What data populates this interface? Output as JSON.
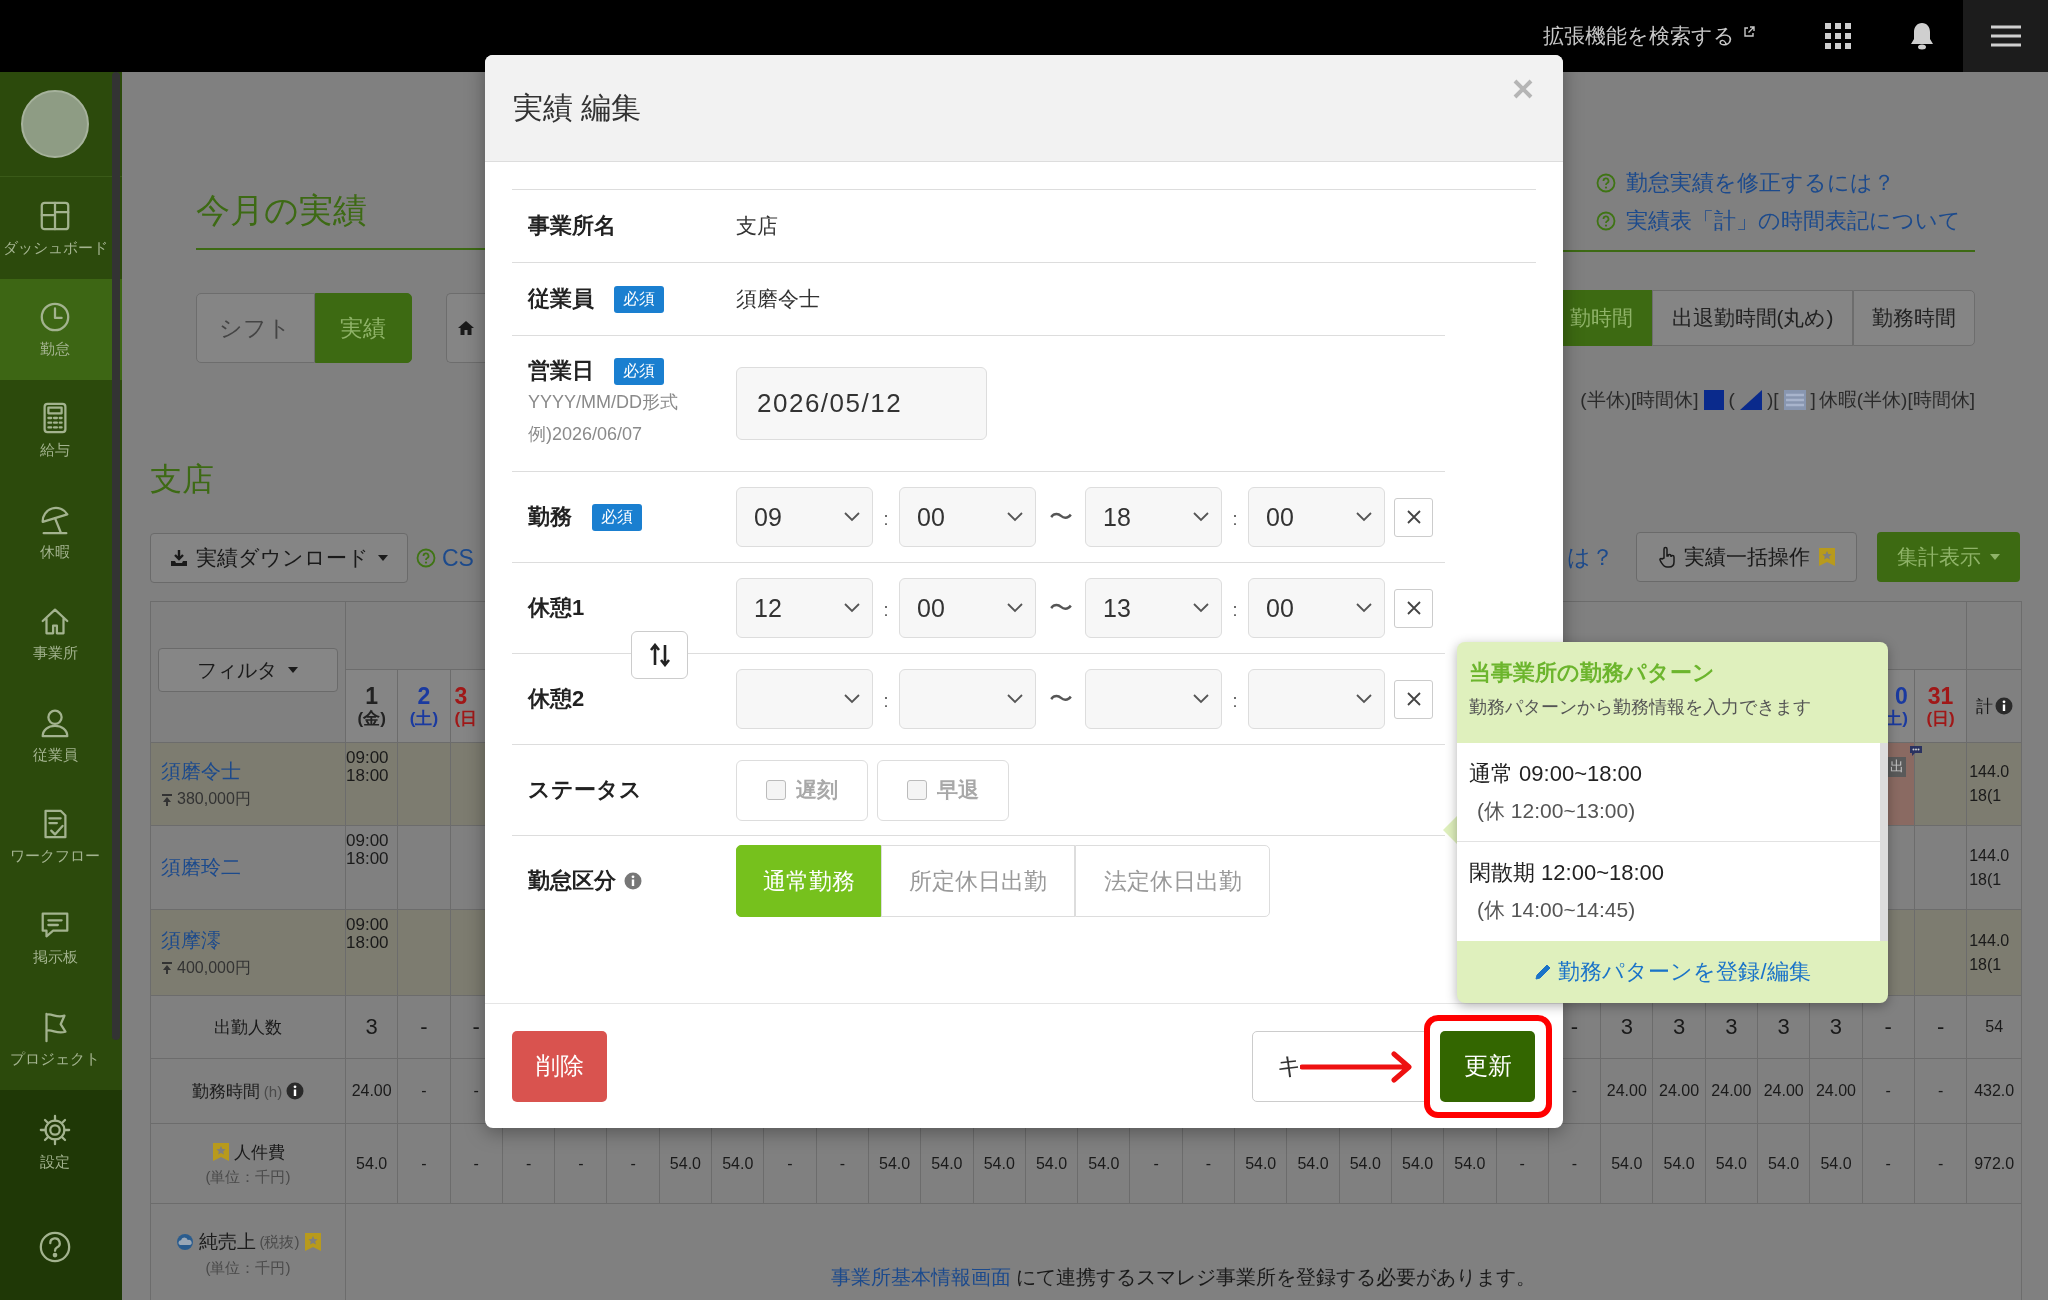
{
  "topbar": {
    "search_link": "拡張機能を検索する"
  },
  "sidebar": {
    "items": [
      {
        "kind": "dashboard",
        "label": "ダッシュボード",
        "selected": false
      },
      {
        "kind": "clock",
        "label": "勤怠",
        "selected": true
      },
      {
        "kind": "calculator",
        "label": "給与",
        "selected": false
      },
      {
        "kind": "umbrella",
        "label": "休暇",
        "selected": false
      },
      {
        "kind": "home",
        "label": "事業所",
        "selected": false
      },
      {
        "kind": "person",
        "label": "従業員",
        "selected": false
      },
      {
        "kind": "checklist",
        "label": "ワークフロー",
        "selected": false
      },
      {
        "kind": "message",
        "label": "掲示板",
        "selected": false
      },
      {
        "kind": "flag",
        "label": "プロジェクト",
        "selected": false
      }
    ],
    "bottom_items": [
      {
        "kind": "gear",
        "label": "設定"
      },
      {
        "kind": "help"
      }
    ]
  },
  "header": {
    "title": "今月の実績",
    "view_tabs": [
      {
        "label": "シフト",
        "selected": false
      },
      {
        "label": "実績",
        "selected": true
      }
    ],
    "help_links": [
      "勤怠実績を修正するには？",
      "実績表「計」の時間表記について"
    ]
  },
  "mode_tabs": [
    {
      "label": "勤時間",
      "selected": true
    },
    {
      "label": "出退勤時間(丸め)",
      "selected": false
    },
    {
      "label": "勤務時間",
      "selected": false
    }
  ],
  "legend": [
    {
      "kind": "text",
      "text": "(半休)[時間休]"
    },
    {
      "kind": "square"
    },
    {
      "kind": "text",
      "text": "("
    },
    {
      "kind": "triangle"
    },
    {
      "kind": "text",
      "text": ")["
    },
    {
      "kind": "lines"
    },
    {
      "kind": "text",
      "text": "]"
    },
    {
      "kind": "text",
      "text": "休暇(半休)[時間休]"
    }
  ],
  "branch": {
    "name": "支店",
    "download_button": "実績ダウンロード",
    "csv_link": "CS",
    "help_link": "は？",
    "bulk_button": "実績一括操作",
    "summary_button": "集計表示"
  },
  "table": {
    "filter_button": "フィルタ",
    "left_days": [
      {
        "kind": "full",
        "day": "1",
        "weekday": "(金)",
        "color": "#222222"
      },
      {
        "kind": "full",
        "day": "2",
        "weekday": "(土)",
        "color": "#1a3aa0"
      },
      {
        "kind": "cut",
        "day": "3",
        "weekday": "(日",
        "color": "#a01818"
      }
    ],
    "right_days": [
      {
        "kind": "cut",
        "day": "0",
        "weekday": "土)",
        "color": "#1a3aa0"
      },
      {
        "kind": "full",
        "day": "31",
        "weekday": "(日)",
        "color": "#a01818"
      }
    ],
    "total_header": "計",
    "employees": [
      {
        "name": "須磨令士",
        "wage": "380,000円",
        "highlighted": true,
        "left_cells": [
          {
            "in": "09:00",
            "out": "18:00"
          }
        ],
        "right_cells": [
          {
            "kind": "flag",
            "badge": "出"
          },
          {
            "kind": "blank"
          }
        ],
        "total": [
          "144.0",
          "18(1"
        ]
      },
      {
        "name": "須磨玲二",
        "highlighted": false,
        "left_cells": [
          {
            "in": "09:00",
            "out": "18:00"
          }
        ],
        "total": [
          "144.0",
          "18(1"
        ]
      },
      {
        "name": "須摩澪",
        "wage": "400,000円",
        "highlighted": true,
        "left_cells": [
          {
            "in": "09:00",
            "out": "18:00"
          }
        ],
        "total": [
          "144.0",
          "18(1"
        ]
      }
    ],
    "summary_rows": [
      {
        "kind": "count",
        "label": "出勤人数",
        "left_cells": [
          "3",
          "-",
          "-"
        ],
        "right_cells": [
          "-",
          "3",
          "3",
          "3",
          "3",
          "3",
          "-",
          "-"
        ],
        "total": "54"
      },
      {
        "kind": "hours",
        "label": "勤務時間",
        "unit": "(h)",
        "left_cells": [
          "24.00",
          "-",
          "-"
        ],
        "right_cells": [
          "-",
          "24.00",
          "24.00",
          "24.00",
          "24.00",
          "24.00",
          "-",
          "-"
        ],
        "total": "432.0"
      },
      {
        "kind": "cost",
        "label": "人件費",
        "sub": "(単位：千円)",
        "left_cells": [
          "54.0",
          "-",
          "-",
          "-",
          "-",
          "-",
          "54.0",
          "54.0",
          "-",
          "-",
          "54.0",
          "54.0",
          "54.0",
          "54.0",
          "54.0",
          "-",
          "-",
          "54.0",
          "54.0",
          "54.0",
          "54.0",
          "54.0",
          "-",
          "-",
          "54.0",
          "54.0",
          "54.0",
          "54.0",
          "54.0",
          "-",
          "-"
        ],
        "total": "972.0"
      }
    ],
    "sales_row": {
      "label": "純売上",
      "suffix": "(税抜)",
      "sub": "(単位：千円)",
      "message_link": "事業所基本情報画面",
      "message": " にて連携するスマレジ事業所を登録する必要があります。"
    }
  },
  "modal": {
    "title": "実績 編集",
    "time_separator": ":",
    "range_mark": "〜",
    "fields": [
      {
        "kind": "text",
        "label": "事業所名",
        "info": false,
        "value": "支店"
      },
      {
        "kind": "text",
        "label": "従業員",
        "required": "必須",
        "info": false,
        "value": "須磨令士"
      },
      {
        "kind": "date",
        "label": "営業日",
        "required": "必須",
        "info": false,
        "hints": [
          "YYYY/MM/DD形式",
          "例)2026/06/07"
        ],
        "value": "2026/05/12"
      },
      {
        "kind": "time-range",
        "label": "勤務",
        "required": "必須",
        "info": false,
        "start": [
          "09",
          "00"
        ],
        "end": [
          "18",
          "00"
        ]
      },
      {
        "kind": "time-range",
        "label": "休憩1",
        "info": false,
        "start": [
          "12",
          "00"
        ],
        "end": [
          "13",
          "00"
        ]
      },
      {
        "kind": "time-range",
        "label": "休憩2",
        "info": false
      },
      {
        "kind": "checkboxes",
        "label": "ステータス",
        "info": false,
        "options": [
          {
            "label": "遅刻",
            "checked": false,
            "disabled": true
          },
          {
            "label": "早退",
            "checked": false,
            "disabled": true
          }
        ]
      },
      {
        "kind": "segmented",
        "label": "勤怠区分",
        "info": true,
        "options": [
          {
            "label": "通常勤務",
            "selected": true
          },
          {
            "label": "所定休日出勤",
            "selected": false
          },
          {
            "label": "法定休日出勤",
            "selected": false
          }
        ]
      }
    ],
    "delete_button": "削除",
    "cancel_button": "キ",
    "update_button": "更新"
  },
  "popover": {
    "title": "当事業所の勤務パターン",
    "subtitle": "勤務パターンから勤務情報を入力できます",
    "patterns": [
      {
        "title": "通常 09:00~18:00",
        "break": "(休 12:00~13:00)"
      },
      {
        "title": "閑散期 12:00~18:00",
        "break": "(休 14:00~14:45)"
      }
    ],
    "edit_link": "勤務パターンを登録/編集"
  }
}
